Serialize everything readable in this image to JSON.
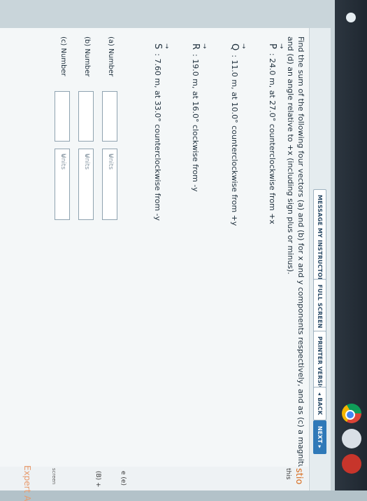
{
  "toolbar": {
    "message": "MESSAGE MY INSTRUCTOR",
    "full_screen": "FULL SCREEN",
    "printer": "PRINTER VERSION",
    "back": "◂ BACK",
    "next": "NEXT ▸"
  },
  "problem": {
    "prompt_line1": "Find the sum of the following four vectors (a) and (b) for x and y components respectively, and as (c) a magnitude",
    "prompt_line2": "and (d) an angle relative to +x (including sign plus or minus).",
    "vectors": [
      {
        "name": "P",
        "text": ": 24.0 m, at 27.0° counterclockwise from +x"
      },
      {
        "name": "Q",
        "text": ": 11.0 m, at 10.0° counterclockwise from +y"
      },
      {
        "name": "R",
        "text": ": 19.0 m, at 16.0° clockwise from -y"
      },
      {
        "name": "S",
        "text": ": 7.60 m, at 33.0° counterclockwise from -y"
      }
    ]
  },
  "answers": [
    {
      "label": "(a) Number",
      "units_placeholder": "Units"
    },
    {
      "label": "(b) Number",
      "units_placeholder": "Units"
    },
    {
      "label": "(c) Number",
      "units_placeholder": "Units"
    }
  ],
  "sidebar": {
    "top": "stio",
    "sub": "this",
    "e_label": "e (e)",
    "b_label": "(B) +",
    "screen": "screen",
    "expert": "Expert A"
  },
  "colors": {
    "accent": "#2f79b8",
    "chegg_orange": "#d86a1b"
  }
}
